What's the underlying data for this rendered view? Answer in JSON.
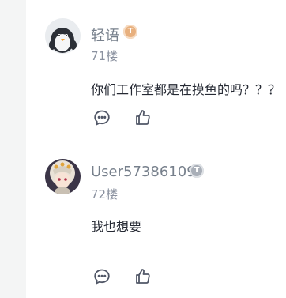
{
  "comments": [
    {
      "author": "轻语",
      "badge": "T",
      "floor": "71楼",
      "text": "你们工作室都是在摸鱼的吗？？？",
      "avatar_icon": "penguin-avatar-icon"
    },
    {
      "author": "User57386109",
      "badge": "T",
      "floor": "72楼",
      "text": "我也想要",
      "avatar_icon": "anime-character-avatar-icon"
    }
  ],
  "icons": {
    "comment": "comment-bubble-icon",
    "like": "thumbs-up-icon"
  },
  "colors": {
    "page_bg": "#f4f5f5",
    "panel_bg": "#ffffff",
    "author": "#77808c",
    "text": "#252933",
    "badge_gold": "#e8b07e",
    "badge_gray": "#a9afb8"
  }
}
